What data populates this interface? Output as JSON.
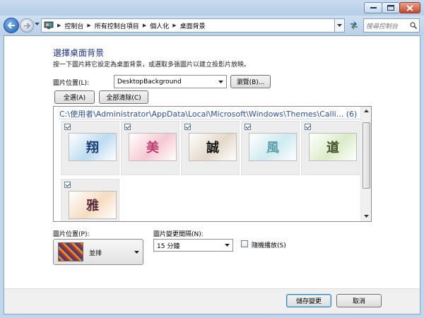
{
  "address": {
    "crumbs": [
      "控制台",
      "所有控制台項目",
      "個人化",
      "桌面背景"
    ],
    "search_placeholder": "搜尋控制台"
  },
  "page": {
    "heading": "選擇桌面背景",
    "subtext": "按一下圖片將它設定為桌面背景，或選取多張圖片以建立投影片放映。"
  },
  "location": {
    "label": "圖片位置(L):",
    "value": "DesktopBackground",
    "browse_label": "瀏覽(B)..."
  },
  "selection": {
    "select_all_label": "全選(A)",
    "clear_all_label": "全部清除(C)"
  },
  "gallery": {
    "group_header": "C:\\使用者\\Administrator\\AppData\\Local\\Microsoft\\Windows\\Themes\\Calli... (6)",
    "items": [
      {
        "glyph": "翔",
        "checked": true,
        "bg": "#bcdcf0",
        "ink": "#1d3f7a"
      },
      {
        "glyph": "美",
        "checked": true,
        "bg": "#f6c9d3",
        "ink": "#c0396b"
      },
      {
        "glyph": "誠",
        "checked": true,
        "bg": "#e3d8c8",
        "ink": "#141414"
      },
      {
        "glyph": "風",
        "checked": true,
        "bg": "#cfeaf0",
        "ink": "#5aa0a8"
      },
      {
        "glyph": "道",
        "checked": true,
        "bg": "#dbecc8",
        "ink": "#3f4f2a"
      },
      {
        "glyph": "雅",
        "checked": true,
        "bg": "#f6dcc0",
        "ink": "#5a2c3c"
      }
    ]
  },
  "position": {
    "label": "圖片位置(P):",
    "value": "並排"
  },
  "interval": {
    "label": "圖片變更間隔(N):",
    "value": "15 分鐘"
  },
  "shuffle": {
    "label": "隨機播放(S)",
    "checked": false
  },
  "footer": {
    "save_label": "儲存變更",
    "cancel_label": "取消"
  },
  "colors": {
    "heading": "#1e3287",
    "group_header": "#2c4f9e",
    "chrome": "#bfd6ec"
  }
}
